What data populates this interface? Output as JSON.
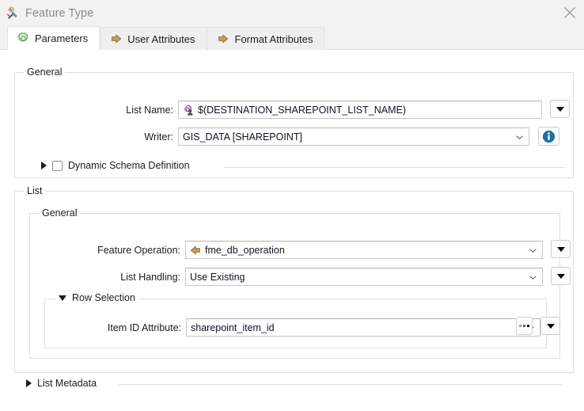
{
  "window": {
    "title": "Feature Type",
    "icon": "feature-type-icon",
    "close_label": "✕"
  },
  "tabs": [
    {
      "label": "Parameters",
      "icon": "gear-icon",
      "active": true
    },
    {
      "label": "User Attributes",
      "icon": "arrow-right-icon",
      "active": false
    },
    {
      "label": "Format Attributes",
      "icon": "arrow-right-icon",
      "active": false
    }
  ],
  "general_group": {
    "legend": "General",
    "list_name": {
      "label": "List Name:",
      "value": "$(DESTINATION_SHAREPOINT_LIST_NAME)",
      "icon": "user-parameter-icon",
      "dropdown_button": "dropdown-arrow"
    },
    "writer": {
      "label": "Writer:",
      "value": "GIS_DATA [SHAREPOINT]",
      "info_button": "info-icon"
    },
    "dynamic_schema": {
      "label": "Dynamic Schema Definition",
      "checked": false,
      "expanded": false
    }
  },
  "list_group": {
    "legend": "List",
    "inner_general": {
      "legend": "General",
      "feature_operation": {
        "label": "Feature Operation:",
        "value": "fme_db_operation",
        "icon": "attribute-arrow-icon",
        "dropdown_button": "dropdown-arrow"
      },
      "list_handling": {
        "label": "List Handling:",
        "value": "Use Existing",
        "dropdown_button": "dropdown-arrow"
      },
      "row_selection": {
        "legend": "Row Selection",
        "expanded": true,
        "item_id_attribute": {
          "label": "Item ID Attribute:",
          "value": "sharepoint_item_id",
          "ellipsis_button": "ellipsis-icon",
          "dropdown_button": "dropdown-arrow"
        }
      }
    }
  },
  "list_metadata": {
    "label": "List Metadata",
    "expanded": false
  },
  "colors": {
    "accent_green": "#6aa84f",
    "accent_tan": "#c08f4a",
    "info_blue": "#1f6fa8",
    "text": "#1c1c1c",
    "border": "#dedede"
  }
}
